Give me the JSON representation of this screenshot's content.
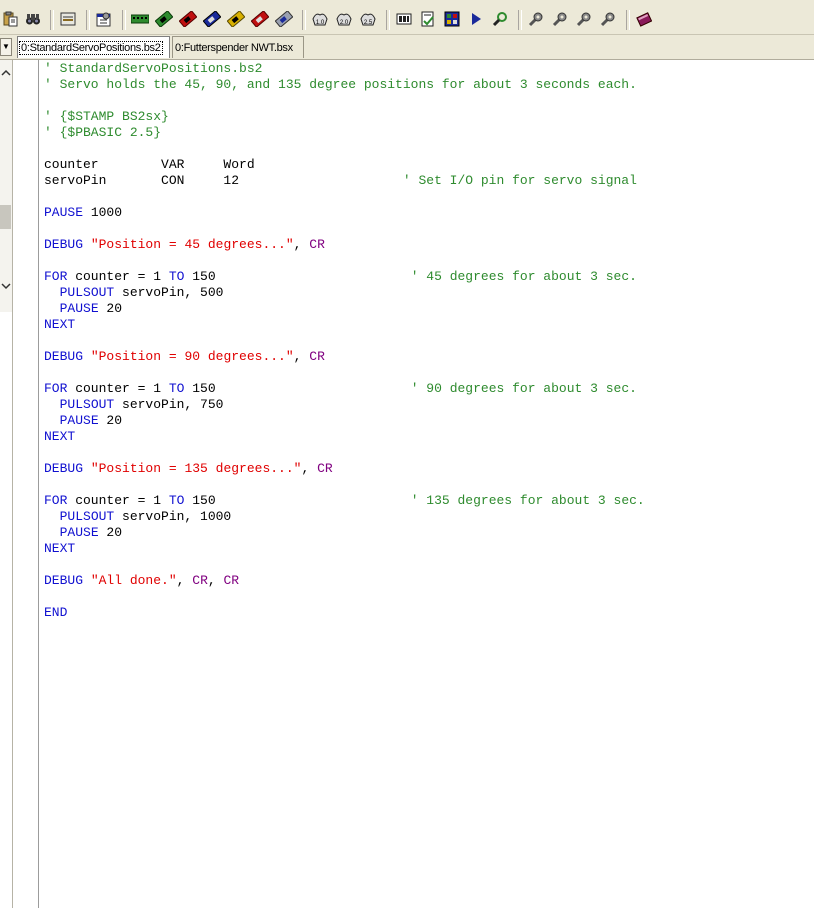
{
  "toolbar": {
    "buttons": [
      {
        "name": "paste-icon"
      },
      {
        "name": "find-icon"
      },
      {
        "name": "serial-port-icon"
      },
      {
        "name": "preferences-icon"
      },
      {
        "name": "bs1-module-icon",
        "color": "#2e8b2e"
      },
      {
        "name": "bs2-module-icon",
        "color": "#2e8b2e"
      },
      {
        "name": "bs2e-module-icon",
        "color": "#c01010"
      },
      {
        "name": "bs2sx-module-icon",
        "color": "#1a2a9a"
      },
      {
        "name": "bs2p-module-icon",
        "color": "#c8a000"
      },
      {
        "name": "bs2pe-module-icon",
        "color": "#c01010"
      },
      {
        "name": "bs2px-module-icon",
        "color": "#1a2a9a"
      },
      {
        "name": "directive-bs1-icon",
        "text": "1.0"
      },
      {
        "name": "directive-bs2-icon",
        "text": "2.0"
      },
      {
        "name": "directive-pbasic-icon",
        "text": "2.5"
      },
      {
        "name": "memory-map-icon"
      },
      {
        "name": "syntax-check-icon"
      },
      {
        "name": "debug-terminal-icon"
      },
      {
        "name": "run-icon",
        "color": "#1a2a9a"
      },
      {
        "name": "identify-icon"
      },
      {
        "name": "tool-1-icon"
      },
      {
        "name": "tool-2-icon"
      },
      {
        "name": "tool-3-icon"
      },
      {
        "name": "tool-4-icon"
      },
      {
        "name": "help-book-icon",
        "color": "#8a1a5a"
      }
    ]
  },
  "tabs": [
    {
      "label": "0:StandardServoPositions.bs2",
      "active": true
    },
    {
      "label": "0:Futterspender NWT.bsx",
      "active": false
    }
  ],
  "colors": {
    "comment": "#2e8b2e",
    "keyword": "#1010d0",
    "string": "#e00000",
    "constant": "#800080",
    "plain": "#000000"
  },
  "code_lines": [
    [
      {
        "t": "' StandardServoPositions.bs2",
        "c": "cm"
      }
    ],
    [
      {
        "t": "' Servo holds the 45, 90, and 135 degree positions for about 3 seconds each.",
        "c": "cm"
      }
    ],
    [],
    [
      {
        "t": "' {$STAMP BS2sx}",
        "c": "cm"
      }
    ],
    [
      {
        "t": "' {$PBASIC 2.5}",
        "c": "cm"
      }
    ],
    [],
    [
      {
        "t": "counter        VAR     Word",
        "c": "plain"
      }
    ],
    [
      {
        "t": "servoPin       CON     12                     ",
        "c": "plain"
      },
      {
        "t": "' Set I/O pin for servo signal",
        "c": "cm"
      }
    ],
    [],
    [
      {
        "t": "PAUSE",
        "c": "kw"
      },
      {
        "t": " 1000",
        "c": "plain"
      }
    ],
    [],
    [
      {
        "t": "DEBUG",
        "c": "kw"
      },
      {
        "t": " ",
        "c": "plain"
      },
      {
        "t": "\"Position = 45 degrees...\"",
        "c": "str"
      },
      {
        "t": ", ",
        "c": "plain"
      },
      {
        "t": "CR",
        "c": "cst"
      }
    ],
    [],
    [
      {
        "t": "FOR",
        "c": "kw"
      },
      {
        "t": " counter = 1 ",
        "c": "plain"
      },
      {
        "t": "TO",
        "c": "kw"
      },
      {
        "t": " 150                         ",
        "c": "plain"
      },
      {
        "t": "' 45 degrees for about 3 sec.",
        "c": "cm"
      }
    ],
    [
      {
        "t": "  ",
        "c": "plain"
      },
      {
        "t": "PULSOUT",
        "c": "kw"
      },
      {
        "t": " servoPin, 500",
        "c": "plain"
      }
    ],
    [
      {
        "t": "  ",
        "c": "plain"
      },
      {
        "t": "PAUSE",
        "c": "kw"
      },
      {
        "t": " 20",
        "c": "plain"
      }
    ],
    [
      {
        "t": "NEXT",
        "c": "kw"
      }
    ],
    [],
    [
      {
        "t": "DEBUG",
        "c": "kw"
      },
      {
        "t": " ",
        "c": "plain"
      },
      {
        "t": "\"Position = 90 degrees...\"",
        "c": "str"
      },
      {
        "t": ", ",
        "c": "plain"
      },
      {
        "t": "CR",
        "c": "cst"
      }
    ],
    [],
    [
      {
        "t": "FOR",
        "c": "kw"
      },
      {
        "t": " counter = 1 ",
        "c": "plain"
      },
      {
        "t": "TO",
        "c": "kw"
      },
      {
        "t": " 150                         ",
        "c": "plain"
      },
      {
        "t": "' 90 degrees for about 3 sec.",
        "c": "cm"
      }
    ],
    [
      {
        "t": "  ",
        "c": "plain"
      },
      {
        "t": "PULSOUT",
        "c": "kw"
      },
      {
        "t": " servoPin, 750",
        "c": "plain"
      }
    ],
    [
      {
        "t": "  ",
        "c": "plain"
      },
      {
        "t": "PAUSE",
        "c": "kw"
      },
      {
        "t": " 20",
        "c": "plain"
      }
    ],
    [
      {
        "t": "NEXT",
        "c": "kw"
      }
    ],
    [],
    [
      {
        "t": "DEBUG",
        "c": "kw"
      },
      {
        "t": " ",
        "c": "plain"
      },
      {
        "t": "\"Position = 135 degrees...\"",
        "c": "str"
      },
      {
        "t": ", ",
        "c": "plain"
      },
      {
        "t": "CR",
        "c": "cst"
      }
    ],
    [],
    [
      {
        "t": "FOR",
        "c": "kw"
      },
      {
        "t": " counter = 1 ",
        "c": "plain"
      },
      {
        "t": "TO",
        "c": "kw"
      },
      {
        "t": " 150                         ",
        "c": "plain"
      },
      {
        "t": "' 135 degrees for about 3 sec.",
        "c": "cm"
      }
    ],
    [
      {
        "t": "  ",
        "c": "plain"
      },
      {
        "t": "PULSOUT",
        "c": "kw"
      },
      {
        "t": " servoPin, 1000",
        "c": "plain"
      }
    ],
    [
      {
        "t": "  ",
        "c": "plain"
      },
      {
        "t": "PAUSE",
        "c": "kw"
      },
      {
        "t": " 20",
        "c": "plain"
      }
    ],
    [
      {
        "t": "NEXT",
        "c": "kw"
      }
    ],
    [],
    [
      {
        "t": "DEBUG",
        "c": "kw"
      },
      {
        "t": " ",
        "c": "plain"
      },
      {
        "t": "\"All done.\"",
        "c": "str"
      },
      {
        "t": ", ",
        "c": "plain"
      },
      {
        "t": "CR",
        "c": "cst"
      },
      {
        "t": ", ",
        "c": "plain"
      },
      {
        "t": "CR",
        "c": "cst"
      }
    ],
    [],
    [
      {
        "t": "END",
        "c": "kw"
      }
    ]
  ]
}
